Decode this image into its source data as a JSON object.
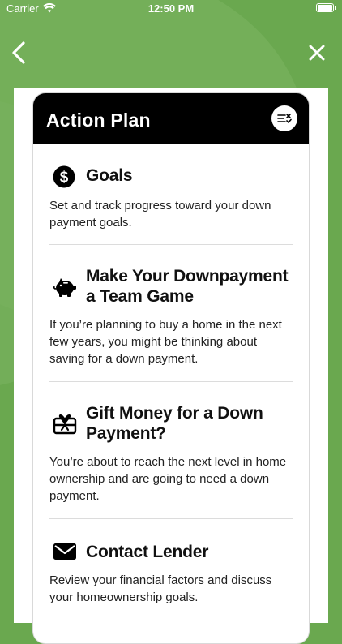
{
  "status_bar": {
    "carrier": "Carrier",
    "time": "12:50 PM"
  },
  "nav": {
    "back_icon": "chevron-left-icon",
    "close_icon": "close-icon"
  },
  "card": {
    "title": "Action Plan",
    "header_button_icon": "list-edit-icon",
    "items": [
      {
        "icon": "dollar-circle-icon",
        "title": "Goals",
        "description": "Set and track progress toward your down payment goals."
      },
      {
        "icon": "piggy-bank-icon",
        "title": "Make Your Downpayment a Team Game",
        "description": "If you’re planning to buy a home in the next few years, you might be thinking about saving for a down payment."
      },
      {
        "icon": "gift-card-icon",
        "title": "Gift Money for a Down Payment?",
        "description": "You’re about to reach the next level in home ownership and are going to need a down payment."
      },
      {
        "icon": "envelope-icon",
        "title": "Contact Lender",
        "description": "Review your financial factors and discuss your homeownership goals."
      }
    ]
  },
  "colors": {
    "background_green": "#6aa84f",
    "header_black": "#000000",
    "card_white": "#ffffff"
  }
}
